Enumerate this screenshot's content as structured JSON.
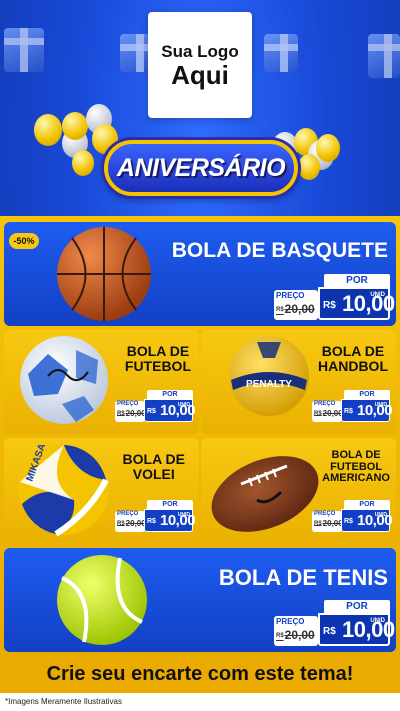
{
  "logo": {
    "line1": "Sua Logo",
    "line2": "Aqui"
  },
  "banner": {
    "text": "ANIVERSÁRIO"
  },
  "discount_badge": "-50%",
  "price_labels": {
    "por": "POR",
    "preco": "PREÇO",
    "unid": "UNID",
    "currency": "R$"
  },
  "products": [
    {
      "name": "BOLA DE BASQUETE",
      "old_price": "20,00",
      "new_price": "10,00"
    },
    {
      "name_line1": "BOLA DE",
      "name_line2": "FUTEBOL",
      "old_price": "20,00",
      "new_price": "10,00"
    },
    {
      "name_line1": "BOLA DE",
      "name_line2": "HANDBOL",
      "old_price": "20,00",
      "new_price": "10,00"
    },
    {
      "name_line1": "BOLA DE",
      "name_line2": "VOLEI",
      "old_price": "20,00",
      "new_price": "10,00"
    },
    {
      "name_line1": "BOLA DE",
      "name_line2": "FUTEBOL",
      "name_line3": "AMERICANO",
      "old_price": "20,00",
      "new_price": "10,00"
    },
    {
      "name": "BOLA DE TENIS",
      "old_price": "20,00",
      "new_price": "10,00"
    }
  ],
  "ball_marks": {
    "penalty": "PENALTY",
    "mikasa": "MIKASA"
  },
  "cta": "Crie seu encarte com este tema!",
  "disclaimer": "*Imagens Meramente Ilustrativas",
  "colors": {
    "blue": "#1240c4",
    "yellow": "#f6c40a",
    "white": "#ffffff"
  }
}
